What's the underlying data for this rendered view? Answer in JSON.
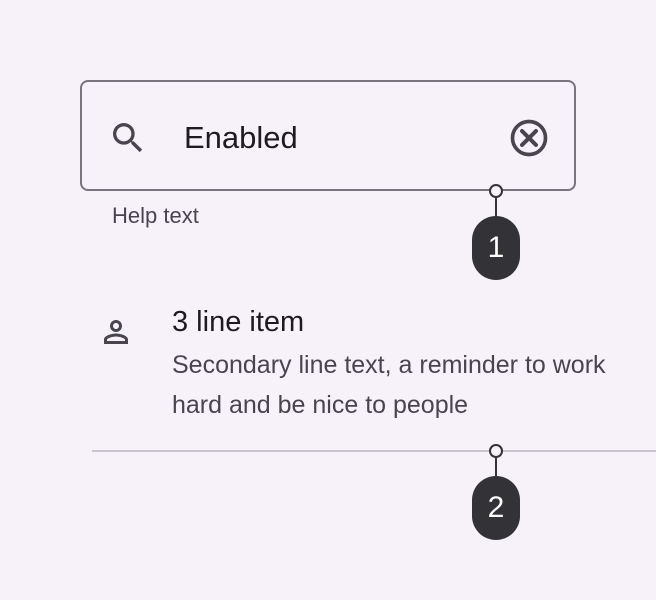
{
  "text_field": {
    "leading_icon": "search-icon",
    "value": "Enabled",
    "trailing_icon": "cancel-icon",
    "supporting_text": "Help text"
  },
  "list_item": {
    "icon": "person-icon",
    "headline": "3 line item",
    "supporting_line_1": "Secondary line text, a reminder to work",
    "supporting_line_2": "hard and be nice to people"
  },
  "callouts": [
    {
      "label": "1"
    },
    {
      "label": "2"
    }
  ],
  "colors": {
    "background": "#f7f2f9",
    "outline": "#79747e",
    "on_surface": "#1d1b20",
    "on_surface_variant": "#49454f",
    "divider": "#cac4d0",
    "callout": "#333236"
  }
}
